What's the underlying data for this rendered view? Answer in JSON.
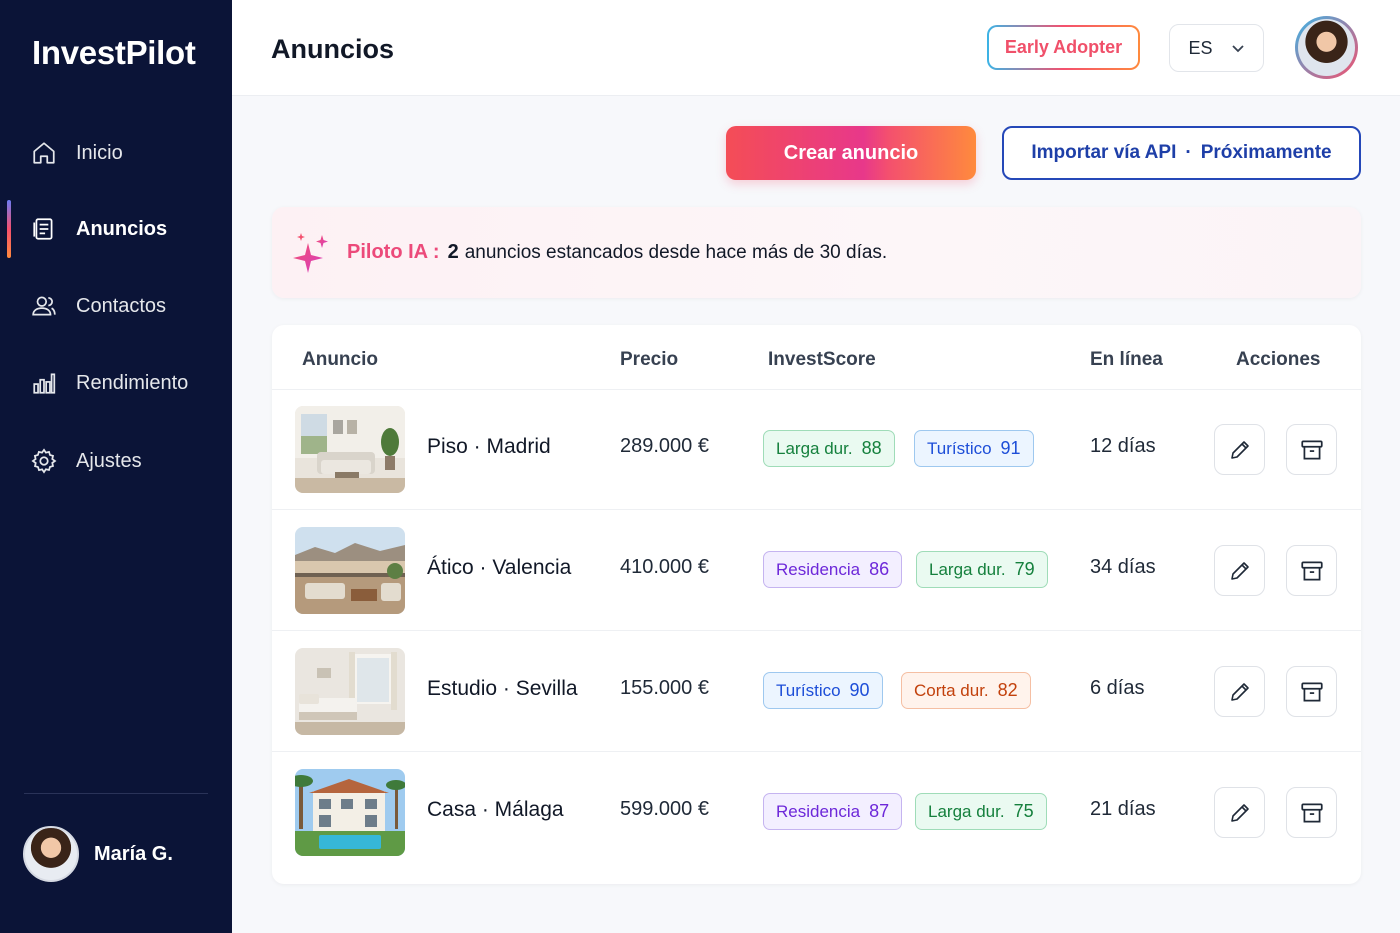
{
  "brand": "InvestPilot",
  "sidebar": {
    "items": [
      {
        "label": "Inicio",
        "icon": "home-icon"
      },
      {
        "label": "Anuncios",
        "icon": "document-icon",
        "active": true
      },
      {
        "label": "Contactos",
        "icon": "users-icon"
      },
      {
        "label": "Rendimiento",
        "icon": "bar-chart-icon"
      },
      {
        "label": "Ajustes",
        "icon": "gear-icon"
      }
    ],
    "user_name": "María G."
  },
  "header": {
    "title": "Anuncios",
    "badge": "Early Adopter",
    "language": "ES"
  },
  "actions": {
    "create_label": "Crear anuncio",
    "import_label": "Importar vía API",
    "import_separator": "·",
    "import_soon": "Próximamente"
  },
  "ai_banner": {
    "label": "Piloto IA :",
    "count": "2",
    "text": "anuncios estancados desde hace más de 30 días."
  },
  "table": {
    "columns": [
      "Anuncio",
      "Precio",
      "InvestScore",
      "En línea",
      "Acciones"
    ],
    "rows": [
      {
        "name": "Piso · Madrid",
        "price": "289.000 €",
        "scores": [
          {
            "label": "Larga dur.",
            "value": "88",
            "color": "green"
          },
          {
            "label": "Turístico",
            "value": "91",
            "color": "blue"
          }
        ],
        "online": "12 días"
      },
      {
        "name": "Ático · Valencia",
        "price": "410.000 €",
        "scores": [
          {
            "label": "Residencia",
            "value": "86",
            "color": "purple"
          },
          {
            "label": "Larga dur.",
            "value": "79",
            "color": "green"
          }
        ],
        "online": "34 días"
      },
      {
        "name": "Estudio · Sevilla",
        "price": "155.000 €",
        "scores": [
          {
            "label": "Turístico",
            "value": "90",
            "color": "blue"
          },
          {
            "label": "Corta dur.",
            "value": "82",
            "color": "orange"
          }
        ],
        "online": "6 días"
      },
      {
        "name": "Casa · Málaga",
        "price": "599.000 €",
        "scores": [
          {
            "label": "Residencia",
            "value": "87",
            "color": "purple"
          },
          {
            "label": "Larga dur.",
            "value": "75",
            "color": "green"
          }
        ],
        "online": "21 días"
      }
    ]
  },
  "colors": {
    "sidebar_bg": "#0b1437",
    "accent_pink": "#ec4a7a",
    "accent_blue": "#1e3fa8"
  }
}
